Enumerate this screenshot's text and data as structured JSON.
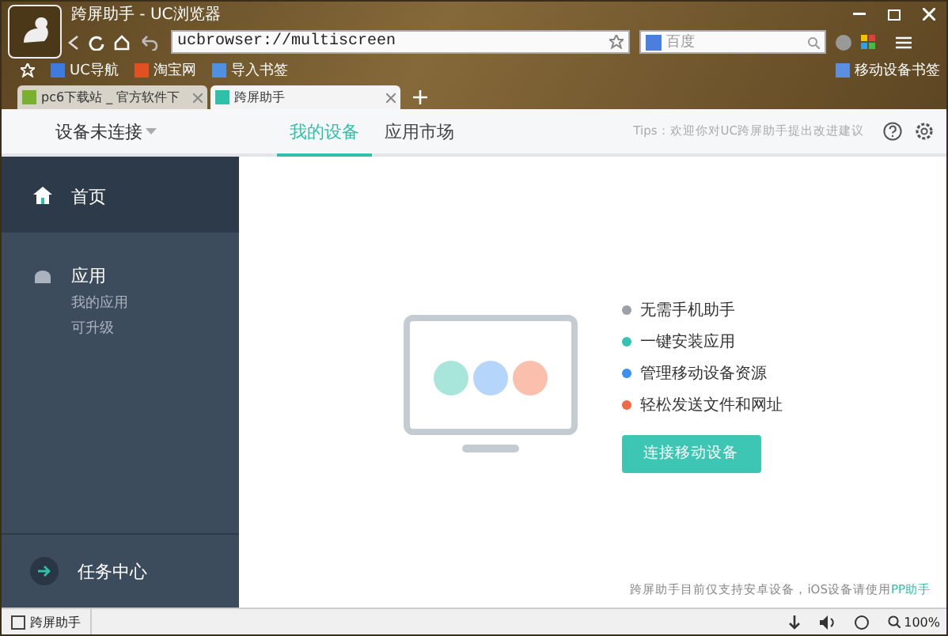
{
  "window": {
    "title": "跨屏助手 - UC浏览器"
  },
  "address": {
    "value": "ucbrowser://multiscreen"
  },
  "search": {
    "placeholder": "百度"
  },
  "bookmarks": [
    {
      "label": "UC导航"
    },
    {
      "label": "淘宝网"
    },
    {
      "label": "导入书签"
    }
  ],
  "bookmark_folder": "移动设备书签",
  "browser_tabs": [
    {
      "label": "pc6下载站 _ 官方软件下",
      "selected": false
    },
    {
      "label": "跨屏助手",
      "selected": true
    }
  ],
  "app": {
    "device_status": "设备未连接",
    "tabs": [
      {
        "label": "我的设备",
        "selected": true
      },
      {
        "label": "应用市场",
        "selected": false
      }
    ],
    "tips": "Tips：欢迎你对UC跨屏助手提出改进建议"
  },
  "sidebar": {
    "items": [
      {
        "label": "首页",
        "selected": true,
        "kind": "home"
      },
      {
        "label": "应用",
        "selected": false,
        "kind": "apps",
        "subitems": [
          "我的应用",
          "可升级"
        ]
      }
    ],
    "footer_item": "任务中心"
  },
  "features": [
    {
      "label": "无需手机助手",
      "color": "#9aa1a8"
    },
    {
      "label": "一键安装应用",
      "color": "#33c3b3"
    },
    {
      "label": "管理移动设备资源",
      "color": "#3d8ff0"
    },
    {
      "label": "轻松发送文件和网址",
      "color": "#f06a4a"
    }
  ],
  "connect_button": "连接移动设备",
  "footer_note": {
    "text": "跨屏助手目前仅支持安卓设备，iOS设备请使用",
    "link": "PP助手"
  },
  "status_bar": {
    "tab": "跨屏助手",
    "zoom": "100%"
  }
}
